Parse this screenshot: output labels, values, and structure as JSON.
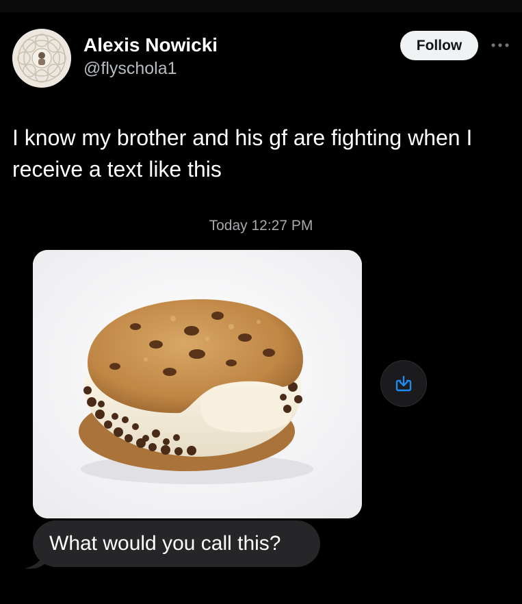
{
  "author": {
    "name": "Alexis Nowicki",
    "handle": "@flyschola1"
  },
  "follow_button": {
    "label": "Follow"
  },
  "tweet": {
    "text": "I know my brother and his gf are fighting when I receive a text like this"
  },
  "screenshot": {
    "timestamp": "Today 12:27 PM",
    "message": "What would you call this?"
  },
  "icons": {
    "more": "more-horizontal-icon",
    "save": "save-image-icon"
  },
  "colors": {
    "background": "#000000",
    "follow_button_bg": "#eff3f4",
    "bubble_bg": "#262629",
    "accent_blue": "#1d8bf1"
  }
}
